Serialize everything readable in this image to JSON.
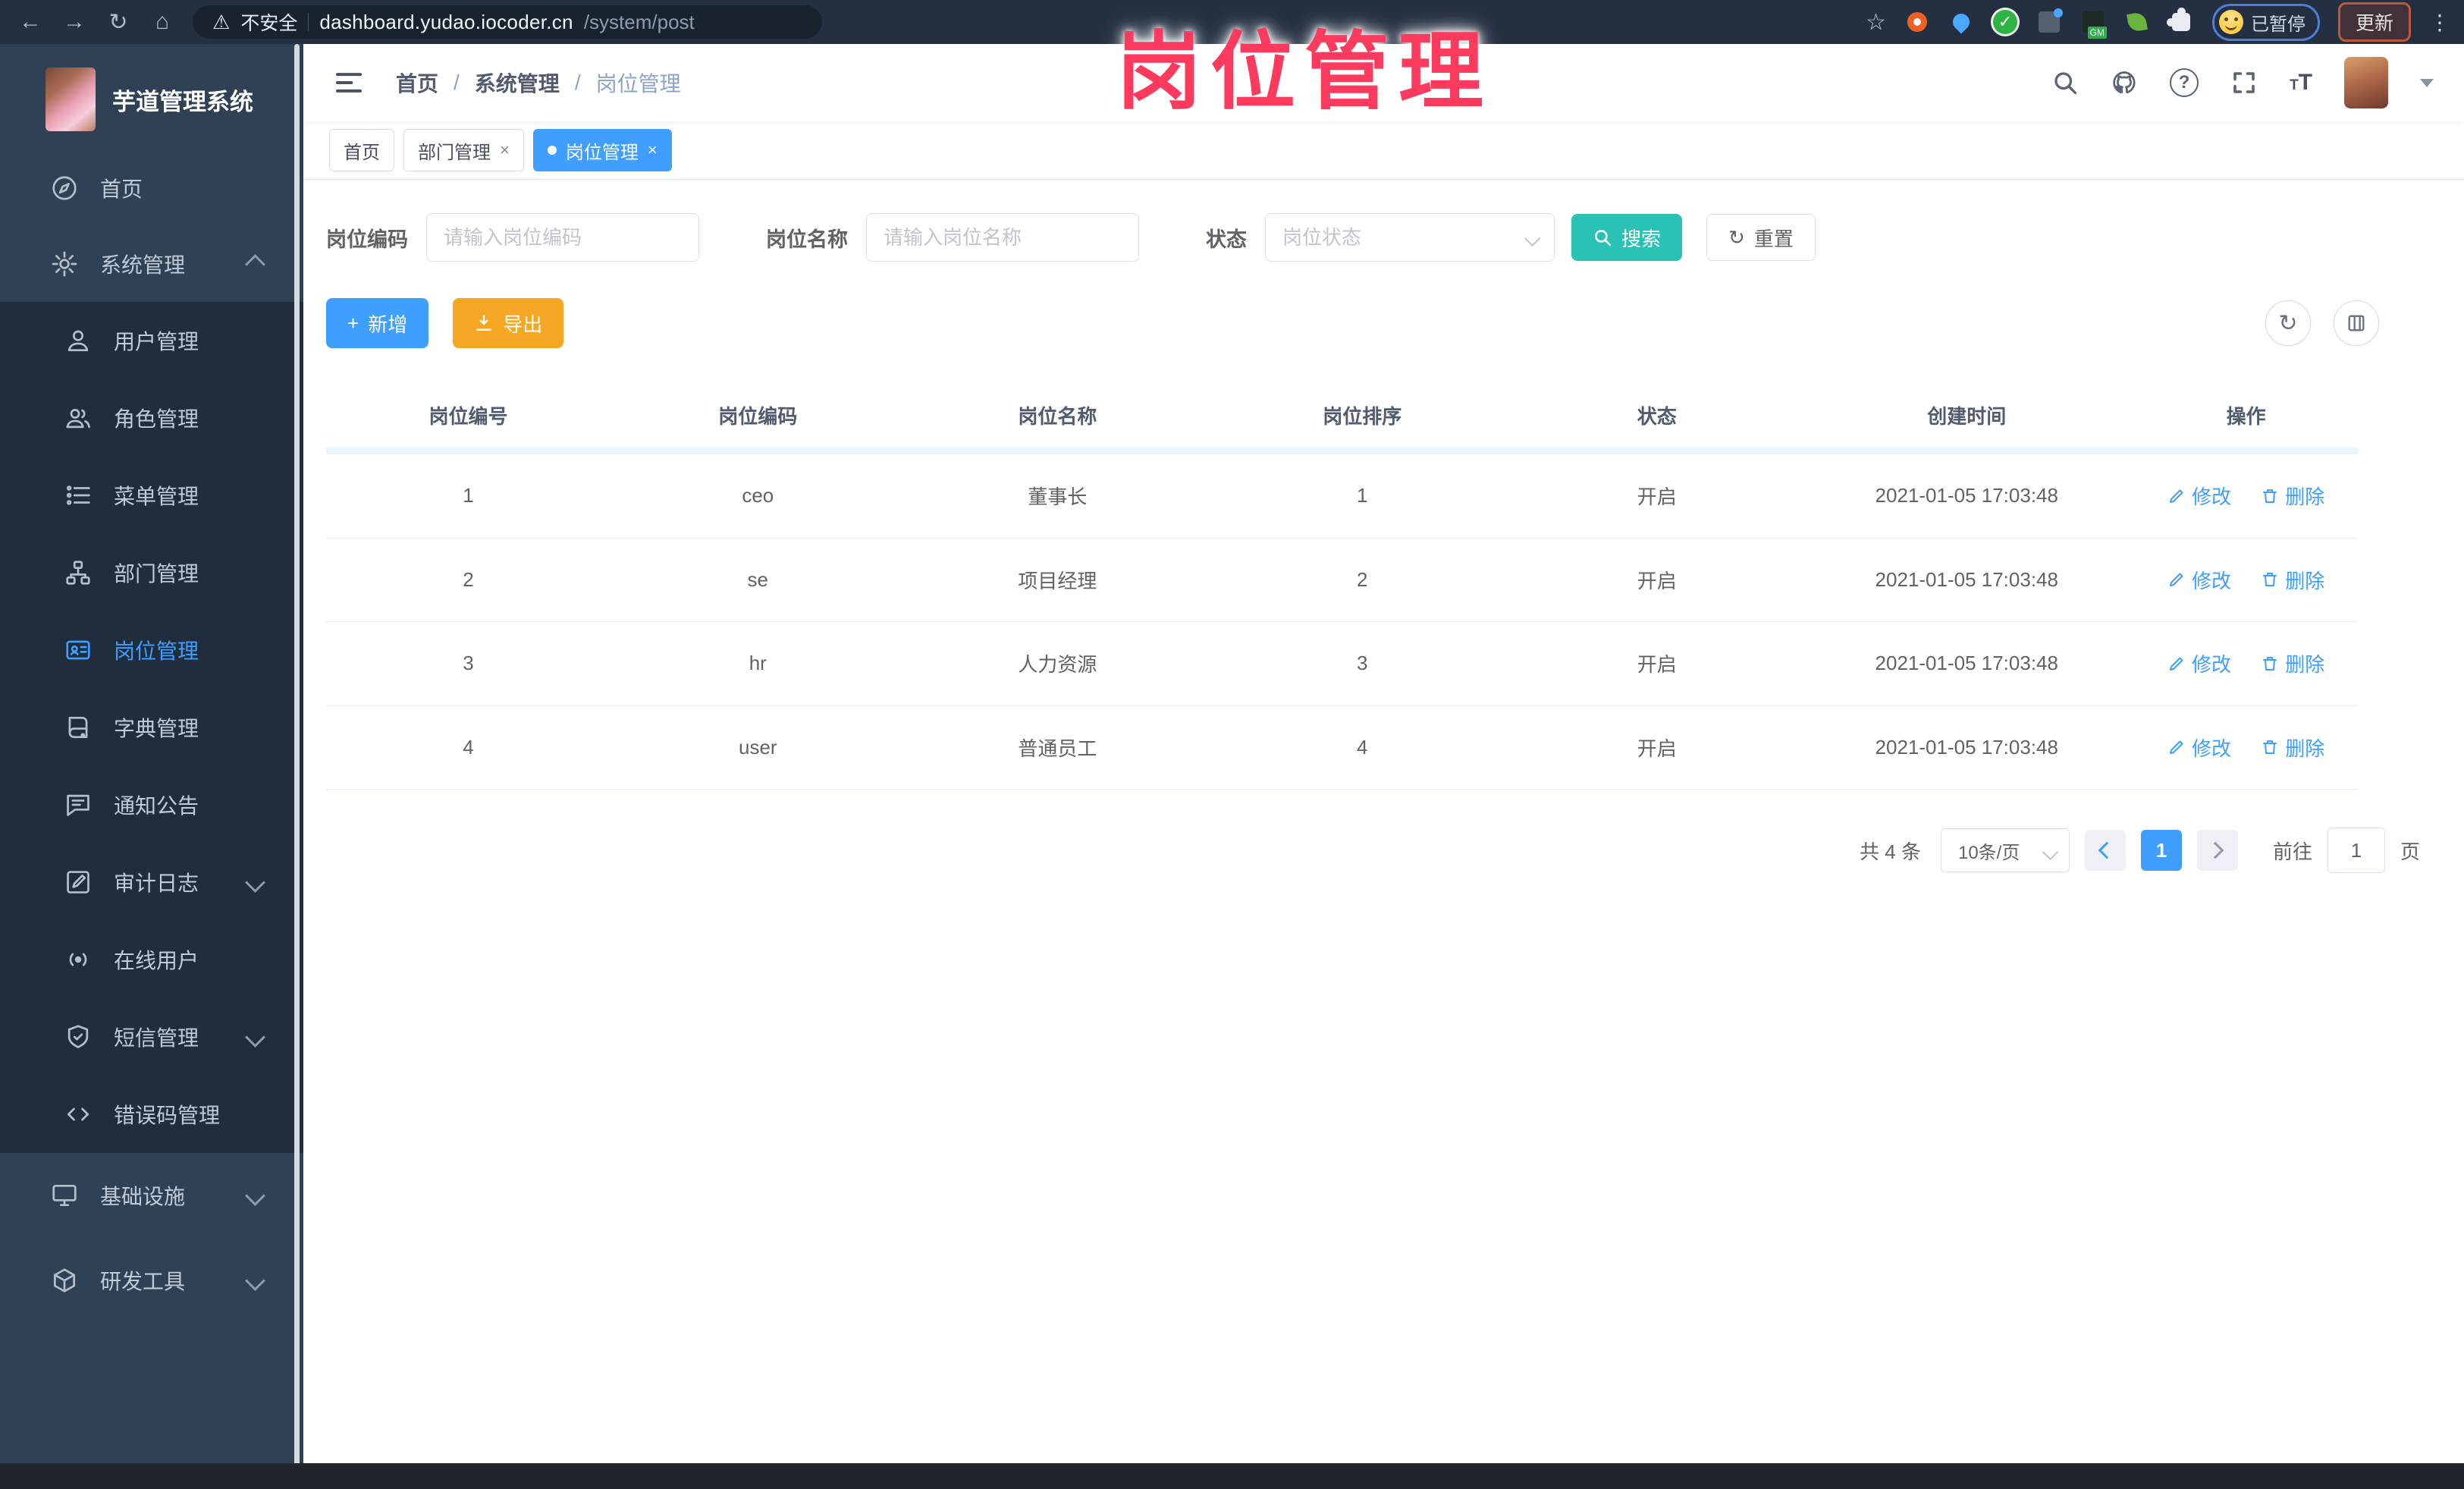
{
  "watermark_text": "岗位管理",
  "browser_bar": {
    "security_label": "不安全",
    "url_host": "dashboard.yudao.iocoder.cn",
    "url_path": "/system/post",
    "paused_badge": "已暂停",
    "update_button": "更新"
  },
  "sidebar": {
    "app_title": "芋道管理系统",
    "items": [
      {
        "label": "首页"
      },
      {
        "label": "系统管理"
      },
      {
        "label": "用户管理"
      },
      {
        "label": "角色管理"
      },
      {
        "label": "菜单管理"
      },
      {
        "label": "部门管理"
      },
      {
        "label": "岗位管理"
      },
      {
        "label": "字典管理"
      },
      {
        "label": "通知公告"
      },
      {
        "label": "审计日志"
      },
      {
        "label": "在线用户"
      },
      {
        "label": "短信管理"
      },
      {
        "label": "错误码管理"
      },
      {
        "label": "基础设施"
      },
      {
        "label": "研发工具"
      }
    ]
  },
  "header": {
    "breadcrumb": {
      "home": "首页",
      "section": "系统管理",
      "current": "岗位管理"
    },
    "tabs": [
      {
        "label": "首页"
      },
      {
        "label": "部门管理"
      },
      {
        "label": "岗位管理"
      }
    ]
  },
  "filters": {
    "code_label": "岗位编码",
    "code_placeholder": "请输入岗位编码",
    "name_label": "岗位名称",
    "name_placeholder": "请输入岗位名称",
    "status_label": "状态",
    "status_placeholder": "岗位状态",
    "search_label": "搜索",
    "reset_label": "重置"
  },
  "toolbar": {
    "add_label": "新增",
    "export_label": "导出"
  },
  "table": {
    "columns": [
      "岗位编号",
      "岗位编码",
      "岗位名称",
      "岗位排序",
      "状态",
      "创建时间",
      "操作"
    ],
    "edit_label": "修改",
    "delete_label": "删除",
    "rows": [
      {
        "id": "1",
        "code": "ceo",
        "name": "董事长",
        "sort": "1",
        "status": "开启",
        "created": "2021-01-05 17:03:48"
      },
      {
        "id": "2",
        "code": "se",
        "name": "项目经理",
        "sort": "2",
        "status": "开启",
        "created": "2021-01-05 17:03:48"
      },
      {
        "id": "3",
        "code": "hr",
        "name": "人力资源",
        "sort": "3",
        "status": "开启",
        "created": "2021-01-05 17:03:48"
      },
      {
        "id": "4",
        "code": "user",
        "name": "普通员工",
        "sort": "4",
        "status": "开启",
        "created": "2021-01-05 17:03:48"
      }
    ]
  },
  "pagination": {
    "total_label": "共 4 条",
    "page_size": "10条/页",
    "current_page": "1",
    "goto_label": "前往",
    "goto_value": "1",
    "page_unit": "页"
  },
  "colors": {
    "accent": "#409eff",
    "search_button": "#2ac2b5",
    "export_button": "#f5a623",
    "sidebar_bg": "#304156",
    "submenu_bg": "#1f2d3d",
    "browser_bar_bg": "#242f41",
    "watermark": "#fb3a5d"
  }
}
